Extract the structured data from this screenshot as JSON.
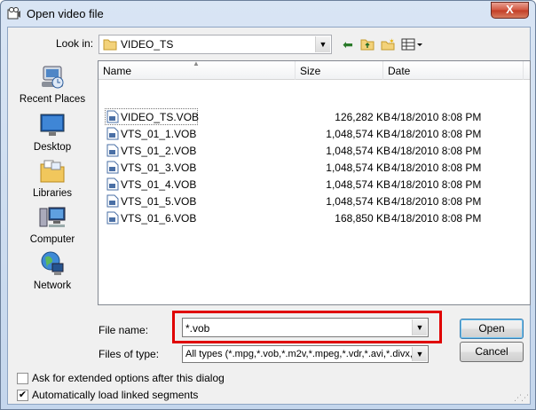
{
  "window": {
    "title": "Open video file",
    "close_label": "X"
  },
  "toolbar": {
    "look_in_label": "Look in:",
    "look_in_value": "VIDEO_TS",
    "buttons": [
      "back-arrow",
      "up-folder",
      "new-folder",
      "view-menu"
    ]
  },
  "places": [
    {
      "label": "Recent Places",
      "icon": "recent-places-icon"
    },
    {
      "label": "Desktop",
      "icon": "desktop-icon"
    },
    {
      "label": "Libraries",
      "icon": "libraries-icon"
    },
    {
      "label": "Computer",
      "icon": "computer-icon"
    },
    {
      "label": "Network",
      "icon": "network-icon"
    }
  ],
  "columns": {
    "name": "Name",
    "size": "Size",
    "date": "Date"
  },
  "files": [
    {
      "name": "VIDEO_TS.VOB",
      "size": "126,282 KB",
      "date": "4/18/2010 8:08 PM"
    },
    {
      "name": "VTS_01_1.VOB",
      "size": "1,048,574 KB",
      "date": "4/18/2010 8:08 PM"
    },
    {
      "name": "VTS_01_2.VOB",
      "size": "1,048,574 KB",
      "date": "4/18/2010 8:08 PM"
    },
    {
      "name": "VTS_01_3.VOB",
      "size": "1,048,574 KB",
      "date": "4/18/2010 8:08 PM"
    },
    {
      "name": "VTS_01_4.VOB",
      "size": "1,048,574 KB",
      "date": "4/18/2010 8:08 PM"
    },
    {
      "name": "VTS_01_5.VOB",
      "size": "1,048,574 KB",
      "date": "4/18/2010 8:08 PM"
    },
    {
      "name": "VTS_01_6.VOB",
      "size": "168,850 KB",
      "date": "4/18/2010 8:08 PM"
    }
  ],
  "form": {
    "file_name_label": "File name:",
    "file_name_value": "*.vob",
    "files_of_type_label": "Files of type:",
    "files_of_type_value": "All types (*.mpg,*.vob,*.m2v,*.mpeg,*.vdr,*.avi,*.divx,*.m"
  },
  "buttons": {
    "open": "Open",
    "cancel": "Cancel"
  },
  "options": [
    {
      "label": "Ask for extended options after this dialog",
      "checked": false
    },
    {
      "label": "Automatically load linked segments",
      "checked": true
    }
  ],
  "colors": {
    "highlight": "#e00000",
    "title_gradient": "#d9e5f4"
  }
}
